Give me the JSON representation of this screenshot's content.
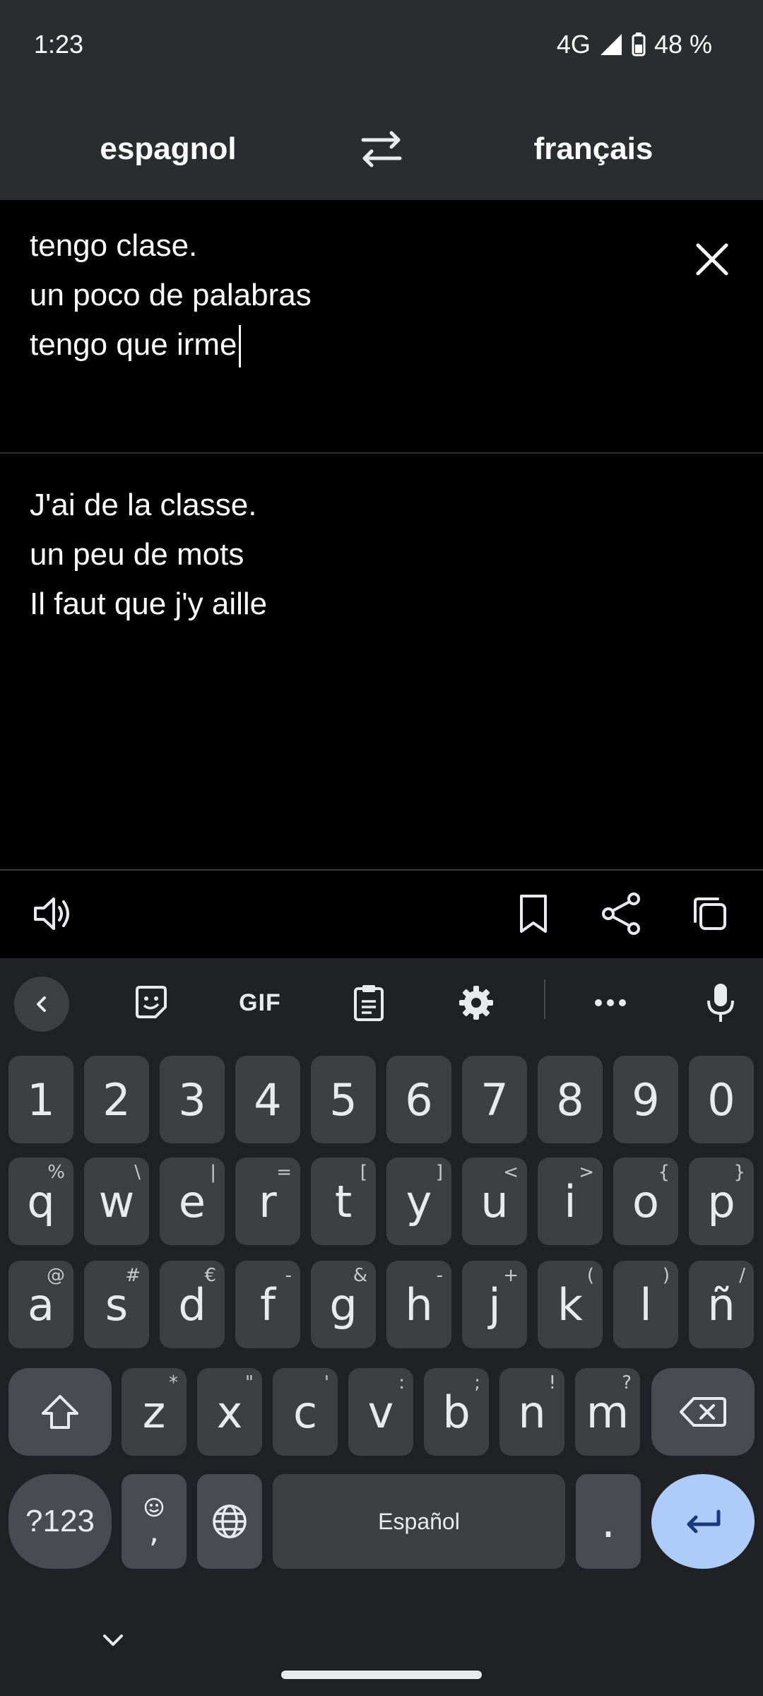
{
  "status": {
    "time": "1:23",
    "network": "4G",
    "battery": "48 %"
  },
  "languages": {
    "source": "espagnol",
    "target": "français"
  },
  "input": {
    "lines": [
      "tengo clase.",
      "un poco de palabras",
      "tengo que irme"
    ]
  },
  "output": {
    "lines": [
      "J'ai de la classe.",
      "un peu de mots",
      "Il faut que j'y aille"
    ]
  },
  "actions": [
    "speaker-icon",
    "bookmark-icon",
    "share-icon",
    "copy-icon"
  ],
  "keyboard": {
    "toolbar": {
      "gif": "GIF"
    },
    "numbers": [
      "1",
      "2",
      "3",
      "4",
      "5",
      "6",
      "7",
      "8",
      "9",
      "0"
    ],
    "row1": [
      {
        "k": "q",
        "h": "%"
      },
      {
        "k": "w",
        "h": "\\"
      },
      {
        "k": "e",
        "h": "|"
      },
      {
        "k": "r",
        "h": "="
      },
      {
        "k": "t",
        "h": "["
      },
      {
        "k": "y",
        "h": "]"
      },
      {
        "k": "u",
        "h": "<"
      },
      {
        "k": "i",
        "h": ">"
      },
      {
        "k": "o",
        "h": "{"
      },
      {
        "k": "p",
        "h": "}"
      }
    ],
    "row2": [
      {
        "k": "a",
        "h": "@"
      },
      {
        "k": "s",
        "h": "#"
      },
      {
        "k": "d",
        "h": "€"
      },
      {
        "k": "f",
        "h": "-"
      },
      {
        "k": "g",
        "h": "&"
      },
      {
        "k": "h",
        "h": "-"
      },
      {
        "k": "j",
        "h": "+"
      },
      {
        "k": "k",
        "h": "("
      },
      {
        "k": "l",
        "h": ")"
      },
      {
        "k": "ñ",
        "h": "/"
      }
    ],
    "row3": [
      {
        "k": "z",
        "h": "*"
      },
      {
        "k": "x",
        "h": "\""
      },
      {
        "k": "c",
        "h": "'"
      },
      {
        "k": "v",
        "h": ":"
      },
      {
        "k": "b",
        "h": ";"
      },
      {
        "k": "n",
        "h": "!"
      },
      {
        "k": "m",
        "h": "?"
      }
    ],
    "sym_label": "?123",
    "comma_label": ",",
    "space_label": "Español",
    "period_label": ".",
    "enter_color": "#aecbfa"
  }
}
